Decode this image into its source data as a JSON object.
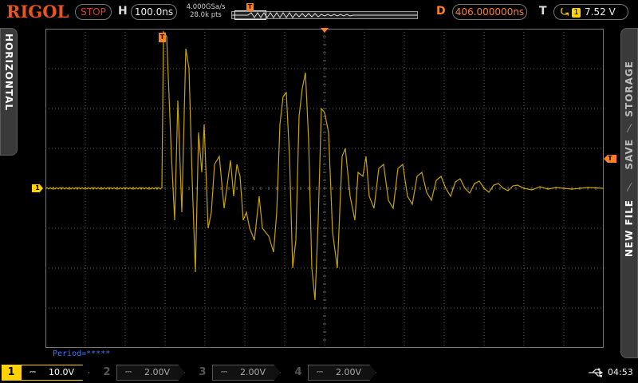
{
  "brand": "RIGOL",
  "run_status": "STOP",
  "horizontal": {
    "label": "H",
    "timebase": "100.0ns",
    "sample_rate": "4.000GSa/s",
    "memory_depth": "28.0k pts"
  },
  "delay": {
    "label": "D",
    "value": "406.000000ns"
  },
  "trigger": {
    "label": "T",
    "edge_icon": "rising-edge-icon",
    "source": "1",
    "level": "7.52 V",
    "marker": "T"
  },
  "side_tabs": {
    "left": "HORIZONTAL",
    "right": [
      "STORAGE",
      "SAVE",
      "NEW FILE"
    ]
  },
  "measurement": "Period=*****",
  "channels": [
    {
      "num": "1",
      "coupling": "DC",
      "scale": "10.0V",
      "active": true
    },
    {
      "num": "2",
      "coupling": "DC",
      "scale": "2.00V",
      "active": false
    },
    {
      "num": "3",
      "coupling": "DC",
      "scale": "2.00V",
      "active": false
    },
    {
      "num": "4",
      "coupling": "DC",
      "scale": "2.00V",
      "active": false
    }
  ],
  "ch1_marker": "1",
  "time": "04:53",
  "colors": {
    "ch1": "#ffd200",
    "trigger": "#ff7f27",
    "brand": "#e8551e",
    "measurement": "#3f72ff"
  }
}
